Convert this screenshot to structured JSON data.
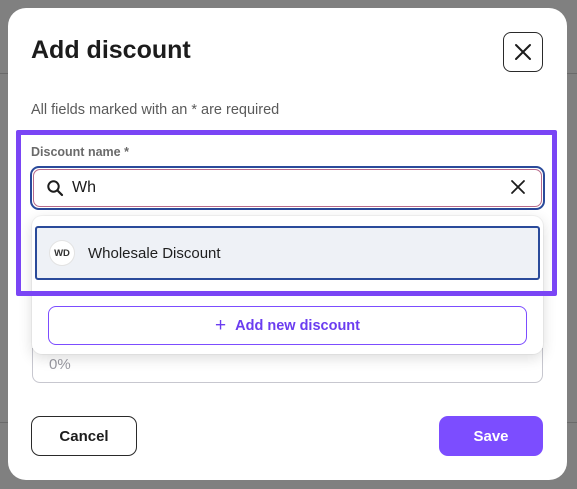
{
  "modal": {
    "title": "Add discount",
    "required_note": "All fields marked with an * are required",
    "close_icon": "close-icon"
  },
  "discount_name_field": {
    "label": "Discount name *",
    "value": "Wh",
    "search_icon": "search-icon",
    "clear_icon": "clear-icon"
  },
  "dropdown": {
    "options": [
      {
        "initials": "WD",
        "label": "Wholesale Discount"
      }
    ],
    "add_new_label": "Add new discount",
    "add_new_icon": "plus-icon"
  },
  "percentage_field": {
    "value": "0%"
  },
  "footer": {
    "cancel_label": "Cancel",
    "save_label": "Save"
  },
  "colors": {
    "accent": "#7c4dff",
    "highlight": "#7a45f5",
    "focus_border": "#2a4a9a"
  }
}
